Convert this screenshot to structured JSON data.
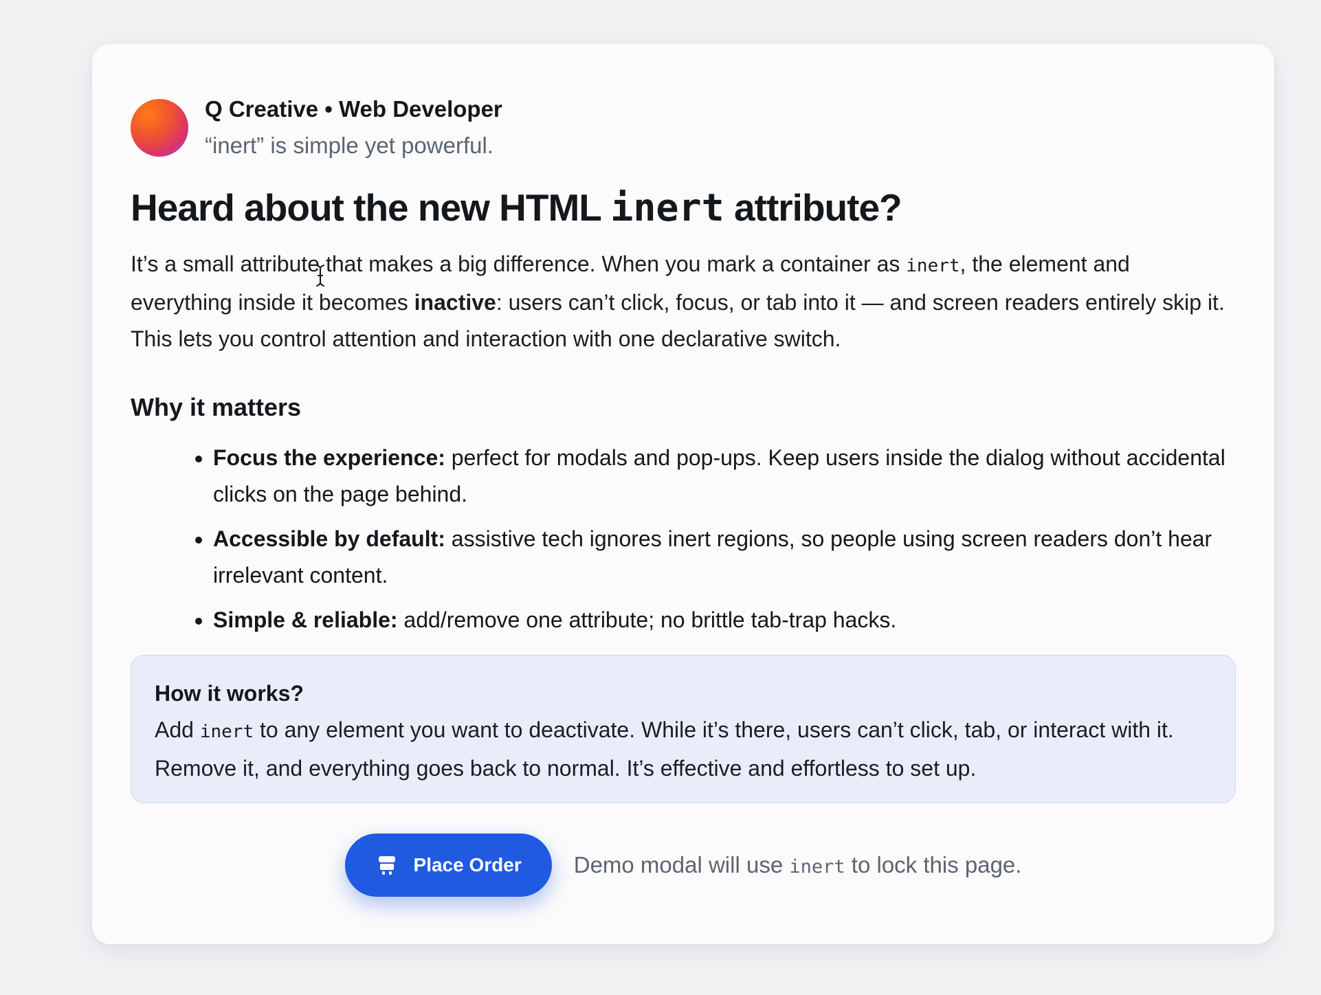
{
  "author": {
    "name": "Q Creative • Web Developer",
    "quote": "“inert” is simple yet powerful."
  },
  "headline": {
    "before": "Heard about the new HTML ",
    "code": "inert",
    "after": " attribute?"
  },
  "intro": {
    "part1": "It’s a small attribute that makes a big difference. When you mark a container as ",
    "code": "inert",
    "part2": ", the element and everything inside it becomes ",
    "bold": "inactive",
    "part3": ": users can’t click, focus, or tab into it — and screen readers entirely skip it. This lets you control attention and interaction with one declarative switch."
  },
  "section_title": "Why it matters",
  "points": [
    {
      "title": "Focus the experience:",
      "text": " perfect for modals and pop-ups. Keep users inside the dialog without accidental clicks on the page behind."
    },
    {
      "title": "Accessible by default:",
      "text": " assistive tech ignores inert regions, so people using screen readers don’t hear irrelevant content."
    },
    {
      "title": "Simple & reliable:",
      "text": " add/remove one attribute; no brittle tab-trap hacks."
    }
  ],
  "callout": {
    "title": "How it works?",
    "part1": "Add ",
    "code": "inert",
    "part2": " to any element you want to deactivate. While it’s there, users can’t click, tab, or interact with it. Remove it, and everything goes back to normal. It’s effective and effortless to set up."
  },
  "action": {
    "button_label": "Place Order",
    "button_icon": "cart-icon",
    "note_part1": "Demo modal will use ",
    "note_code": "inert",
    "note_part2": " to lock this page."
  },
  "colors": {
    "accent": "#1f5ae0",
    "callout_bg": "#e8edf9",
    "muted_text": "#5b6472"
  }
}
